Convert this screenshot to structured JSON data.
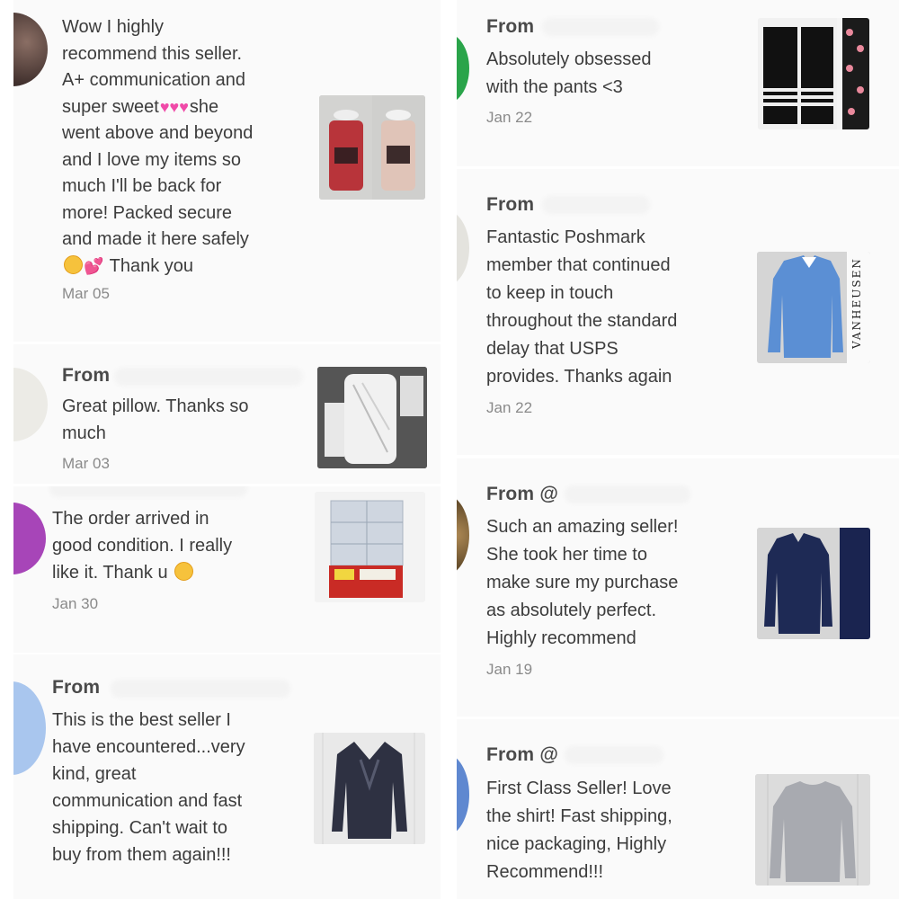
{
  "colors": {
    "heart": "#f04aa8",
    "muted": "#8a8a8a"
  },
  "reviews": {
    "r1": {
      "lines": [
        "Wow I highly",
        "recommend this seller.",
        "A+ communication and",
        "super sweet",
        "she",
        "went above and beyond",
        "and I love my items so",
        "much I'll be back for",
        "more! Packed secure",
        "and made it here safely",
        "Thank you"
      ],
      "hearts": "♥♥♥",
      "emoji2": "😊💕",
      "date": "Mar 05",
      "image": "candle-jars-photo"
    },
    "r2": {
      "from": "From",
      "lines": [
        "Great pillow. Thanks so",
        "much"
      ],
      "date": "Mar 03",
      "image": "pillow-photo"
    },
    "r3": {
      "lines": [
        "The order arrived in",
        "good condition. I really",
        "like it. Thank u"
      ],
      "date": "Jan 30",
      "image": "storage-boxes-photo"
    },
    "r4": {
      "from": "From",
      "lines": [
        "This is the best seller I",
        "have encountered...very",
        "kind, great",
        "communication and fast",
        "shipping. Can't wait to",
        "buy from them again!!!"
      ],
      "image": "navy-cardigan-photo"
    },
    "r5": {
      "from": "From",
      "lines": [
        "Absolutely obsessed",
        "with the pants <3"
      ],
      "date": "Jan 22",
      "image": "black-pants-photo"
    },
    "r6": {
      "from": "From",
      "lines": [
        "Fantastic Poshmark",
        "member that continued",
        "to keep in touch",
        "throughout the standard",
        "delay that USPS",
        "provides. Thanks again"
      ],
      "date": "Jan 22",
      "brand": "VANHEUSEN",
      "image": "blue-dress-shirt-photo"
    },
    "r7": {
      "from": "From @",
      "lines": [
        "Such an amazing seller!",
        "She took her time to",
        "make sure my purchase",
        "as absolutely perfect.",
        "Highly recommend"
      ],
      "date": "Jan 19",
      "image": "navy-shirt-photo"
    },
    "r8": {
      "from": "From @",
      "lines": [
        "First Class Seller! Love",
        "the shirt! Fast shipping,",
        "nice packaging, Highly",
        "Recommend!!!"
      ],
      "image": "grey-sweater-photo"
    }
  }
}
